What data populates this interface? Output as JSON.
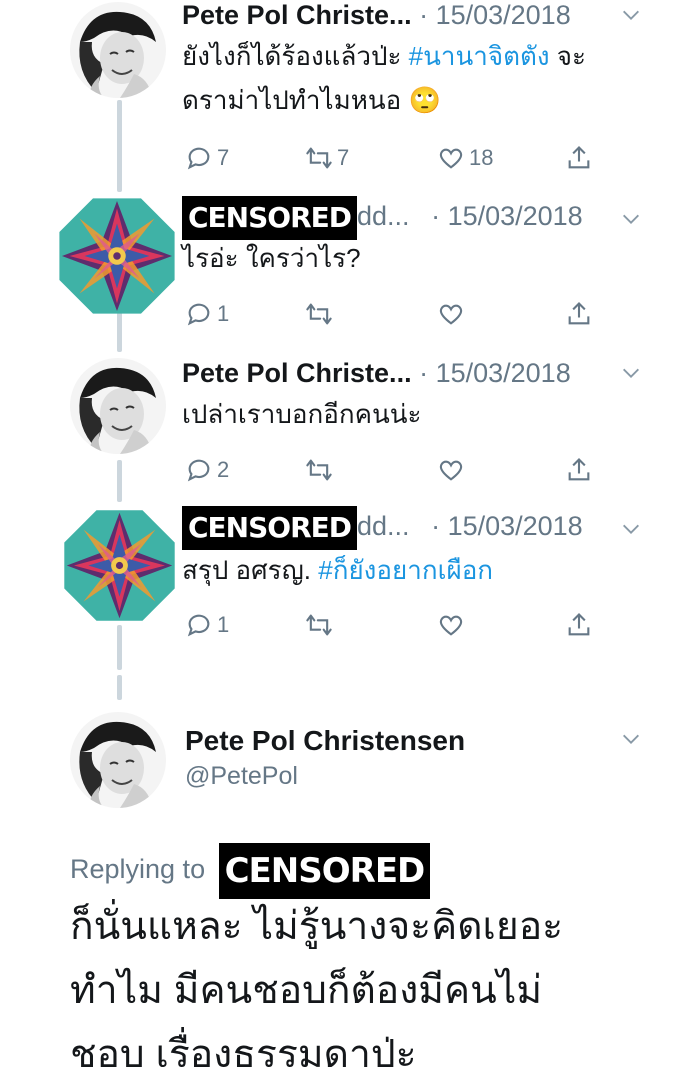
{
  "thread": [
    {
      "author": "Pete Pol Christe...",
      "censored_author": false,
      "date": "· 15/03/2018",
      "text_parts": [
        {
          "t": "ยังไงก็ได้ร้องแล้วป่ะ ",
          "tag": false
        },
        {
          "t": "#นานาจิตตัง",
          "tag": true
        },
        {
          "t": " จะ",
          "tag": false
        }
      ],
      "text_line2": "ดราม่าไปทำไมหนอ 🙄",
      "replies": "7",
      "retweets": "7",
      "likes": "18"
    },
    {
      "author_suffix": "dd...",
      "censored_label": "CENSORED",
      "censored_author": true,
      "date": "· 15/03/2018",
      "text": "ไรอ่ะ ใครว่าไร?",
      "replies": "1",
      "retweets": "",
      "likes": ""
    },
    {
      "author": "Pete Pol Christe...",
      "censored_author": false,
      "date": "· 15/03/2018",
      "text": "เปล่าเราบอกอีกคนน่ะ",
      "replies": "2",
      "retweets": "",
      "likes": ""
    },
    {
      "author_suffix": "dd...",
      "censored_label": "CENSORED",
      "censored_author": true,
      "date": "· 15/03/2018",
      "text_plain": "สรุป อศรญ. ",
      "text_tag": "#ก็ยังอยากเผือก",
      "replies": "1",
      "retweets": "",
      "likes": ""
    }
  ],
  "main_tweet": {
    "name": "Pete Pol Christensen",
    "handle": "@PetePol",
    "replying_to": "Replying to",
    "replying_censored": "CENSORED",
    "lines": [
      "ก็นั่นแหละ ไม่รู้นางจะคิดเยอะ",
      "ทำไม มีคนชอบก็ต้องมีคนไม่",
      "ชอบ เรื่องธรรมดาป่ะ"
    ]
  },
  "colors": {
    "text": "#14171a",
    "muted": "#657786",
    "hashtag": "#1b95e0",
    "thread_line": "#ccd6dd"
  },
  "icons": [
    "reply-icon",
    "retweet-icon",
    "like-icon",
    "share-icon",
    "chevron-down-icon"
  ]
}
